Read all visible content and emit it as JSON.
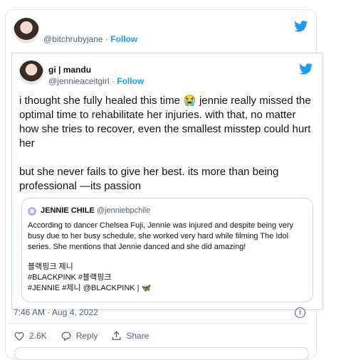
{
  "outer": {
    "handle": "@bitchrubyjane",
    "follow_label": "Follow"
  },
  "inner": {
    "name": "gi | mandu",
    "handle": "@jennieaceitgirl",
    "follow_label": "Follow",
    "text_p1": "i thought she fully healed this time 😭 jennie really missed the optimal time to rehabilitate her injuries. with that, no matter how she tries to recover, even the smallest misstep could hurt her",
    "text_p2": "but she never fails to give her best. its more than being professional —its passion"
  },
  "quote": {
    "name": "JENNIE CHILE",
    "handle": "@jenniebpchile",
    "body": "According to dancer Chelsea Fuji, Jennie was injured and despite being very busy due to her busy schedule, she worked very hard while filming The Idol series. She mentions that Jennie danced and she did amazing!",
    "tag_line1": "블랙핑크 제니",
    "tag_line2": "#BLACKPINK #블랙핑크",
    "tag_line3": "#JENNIE #제니 @BLACKPINK | 🦋"
  },
  "meta": {
    "timestamp": "7:46 AM · Aug 4, 2022"
  },
  "actions": {
    "likes": "2.6K",
    "reply_label": "Reply",
    "share_label": "Share"
  },
  "colors": {
    "twitter_blue": "#1d9bf0",
    "like_red": "#e0245e"
  },
  "icons": [
    "twitter-bird-icon",
    "heart-icon",
    "reply-icon",
    "share-icon",
    "info-icon"
  ]
}
